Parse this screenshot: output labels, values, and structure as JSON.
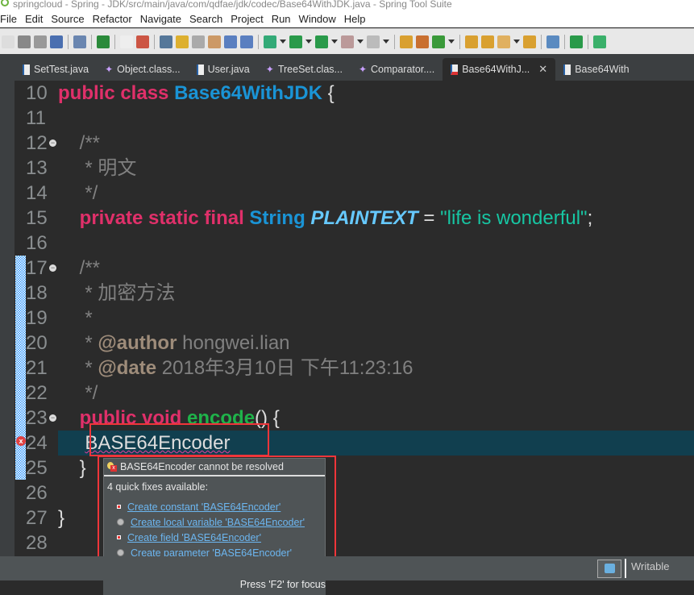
{
  "window": {
    "title": "springcloud - Spring - JDK/src/main/java/com/qdfae/jdk/codec/Base64WithJDK.java - Spring Tool Suite"
  },
  "menu": [
    "File",
    "Edit",
    "Source",
    "Refactor",
    "Navigate",
    "Search",
    "Project",
    "Run",
    "Window",
    "Help"
  ],
  "tabs": [
    {
      "label": "SetTest.java",
      "icon": "java-file-icon"
    },
    {
      "label": "Object.class...",
      "icon": "class-file-icon"
    },
    {
      "label": "User.java",
      "icon": "java-file-icon"
    },
    {
      "label": "TreeSet.clas...",
      "icon": "class-file-icon"
    },
    {
      "label": "Comparator....",
      "icon": "class-file-icon"
    },
    {
      "label": "Base64WithJ...",
      "icon": "java-file-error-icon",
      "active": true
    },
    {
      "label": "Base64With",
      "icon": "java-file-icon"
    }
  ],
  "editor": {
    "lines": [
      {
        "n": "10",
        "html": "<span class='kw'>public class</span> <span class='ty'>Base64WithJDK</span> {"
      },
      {
        "n": "11",
        "html": ""
      },
      {
        "n": "12",
        "fold": true,
        "html": "    <span class='cm'>/**</span>"
      },
      {
        "n": "13",
        "html": "     <span class='cm'>* 明文</span>"
      },
      {
        "n": "14",
        "html": "     <span class='cm'>*/</span>"
      },
      {
        "n": "15",
        "html": "    <span class='kw'>private static final</span> <span class='ty'>String</span> <span class='fi'>PLAINTEXT</span> = <span class='st'>\"life is wonderful\"</span>;"
      },
      {
        "n": "16",
        "html": ""
      },
      {
        "n": "17",
        "fold": true,
        "html": "    <span class='cm'>/**</span>"
      },
      {
        "n": "18",
        "html": "     <span class='cm'>* 加密方法</span>"
      },
      {
        "n": "19",
        "html": "     <span class='cm'>*</span>"
      },
      {
        "n": "20",
        "html": "     <span class='cm'>* </span><span class='tag'>@author</span><span class='cm'> hongwei.lian</span>"
      },
      {
        "n": "21",
        "html": "     <span class='cm'>* </span><span class='tag'>@date</span><span class='cm'> 2018年3月10日 下午11:23:16</span>"
      },
      {
        "n": "22",
        "html": "     <span class='cm'>*/</span>"
      },
      {
        "n": "23",
        "fold": true,
        "html": "    <span class='kw'>public void</span> <span class='mth'>encode</span>() {"
      },
      {
        "n": "24",
        "current": true,
        "error": true,
        "html": "     <span class='err'>BASE64Encoder</span>"
      },
      {
        "n": "25",
        "html": "    }"
      },
      {
        "n": "26",
        "html": ""
      },
      {
        "n": "27",
        "html": "}"
      },
      {
        "n": "28",
        "html": ""
      }
    ]
  },
  "quickfix": {
    "error": "BASE64Encoder cannot be resolved",
    "subtitle": "4 quick fixes available:",
    "fixes": [
      {
        "label": "Create constant 'BASE64Encoder'",
        "icon": "constant-icon"
      },
      {
        "label": "Create local variable 'BASE64Encoder'",
        "icon": "local-variable-icon"
      },
      {
        "label": "Create field 'BASE64Encoder'",
        "icon": "field-icon"
      },
      {
        "label": "Create parameter 'BASE64Encoder'",
        "icon": "parameter-icon"
      }
    ],
    "focus_hint": "Press 'F2' for focus"
  },
  "status": {
    "writable": "Writable"
  },
  "colors": {
    "highlight_box": "#f0353a",
    "current_line": "#113f4f"
  }
}
